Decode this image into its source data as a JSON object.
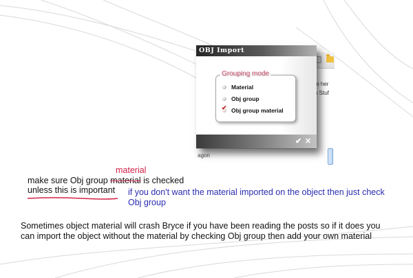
{
  "dialog": {
    "title": "OBJ Import",
    "group_label": "Grouping mode",
    "options": [
      {
        "label": "Material",
        "selected": false
      },
      {
        "label": "Obj group",
        "selected": false
      },
      {
        "label": "Obj group material",
        "selected": true
      }
    ],
    "ok_icon": "check-icon",
    "ok_glyph": "✔",
    "cancel_icon": "close-icon",
    "cancel_glyph": "✕"
  },
  "background_app": {
    "lines": [
      "m her",
      "n Stuf"
    ],
    "bottom_fragment": "agon"
  },
  "annotations": {
    "inserted_word": "material",
    "line1_prefix": "make sure Obj group ",
    "line1_struck": "material",
    "line1_suffix": " is checked",
    "line2": "unless this is important",
    "blue_note_line1": "if you don't want the material imported on the object then just check",
    "blue_note_line2": "Obj group",
    "paragraph": "Sometimes object material will crash Bryce if you have been reading the posts so if it does you can import the object without the material by checking Obj group then add your own material"
  },
  "colors": {
    "annotation_red": "#d22248",
    "annotation_blue": "#2a2cb0",
    "group_title_pink": "#d05070"
  }
}
